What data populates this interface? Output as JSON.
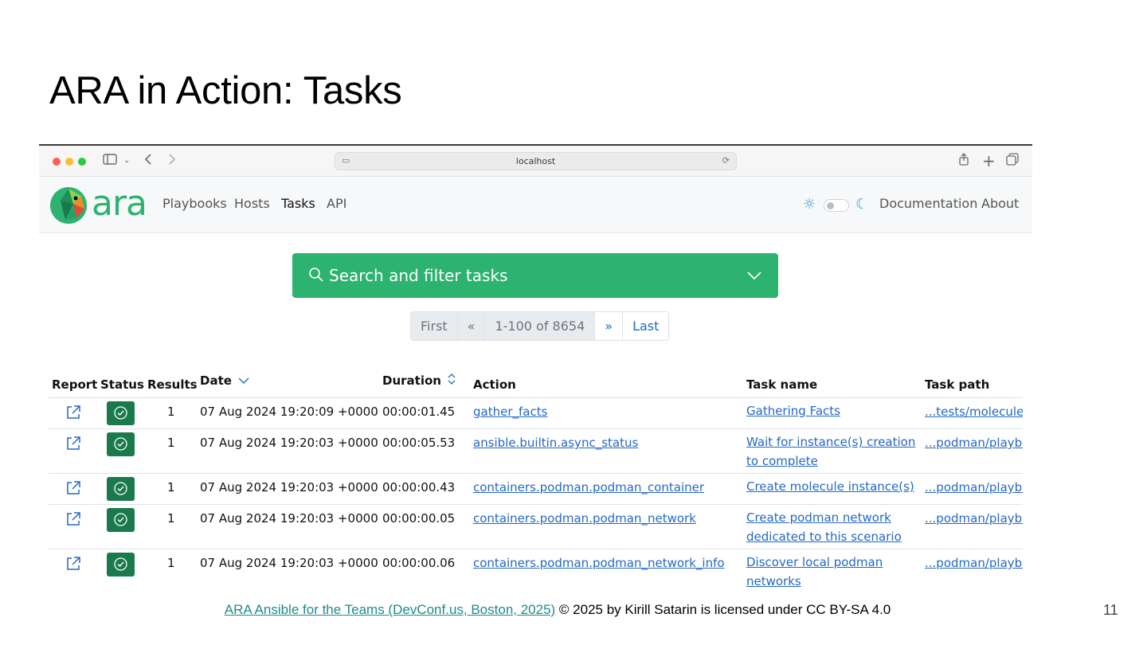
{
  "slide": {
    "title": "ARA in Action: Tasks",
    "page_number": "11",
    "footer_link": "ARA Ansible for the Teams (DevConf.us, Boston, 2025)",
    "footer_text": " © 2025 by Kirill Satarin is licensed under CC BY-SA 4.0"
  },
  "browser": {
    "url": "localhost"
  },
  "navbar": {
    "brand": "ara",
    "links": [
      "Playbooks",
      "Hosts",
      "Tasks",
      "API"
    ],
    "active": "Tasks",
    "right_links": [
      "Documentation",
      "About"
    ]
  },
  "search": {
    "label": "Search and filter tasks"
  },
  "pagination": {
    "first": "First",
    "prev": "«",
    "range": "1-100 of 8654",
    "next": "»",
    "last": "Last"
  },
  "table": {
    "columns": [
      "Report",
      "Status",
      "Results",
      "Date",
      "Duration",
      "Action",
      "Task name",
      "Task path"
    ],
    "rows": [
      {
        "results": "1",
        "date": "07 Aug 2024 19:20:09 +0000",
        "duration": "00:00:01.45",
        "action": "gather_facts",
        "task_name": "Gathering Facts",
        "task_path": "...tests/molecule/"
      },
      {
        "results": "1",
        "date": "07 Aug 2024 19:20:03 +0000",
        "duration": "00:00:05.53",
        "action": "ansible.builtin.async_status",
        "task_name": "Wait for instance(s) creation to complete",
        "task_path": "...podman/playbo"
      },
      {
        "results": "1",
        "date": "07 Aug 2024 19:20:03 +0000",
        "duration": "00:00:00.43",
        "action": "containers.podman.podman_container",
        "task_name": "Create molecule instance(s)",
        "task_path": "...podman/playbo"
      },
      {
        "results": "1",
        "date": "07 Aug 2024 19:20:03 +0000",
        "duration": "00:00:00.05",
        "action": "containers.podman.podman_network",
        "task_name": "Create podman network dedicated to this scenario",
        "task_path": "...podman/playbo"
      },
      {
        "results": "1",
        "date": "07 Aug 2024 19:20:03 +0000",
        "duration": "00:00:00.06",
        "action": "containers.podman.podman_network_info",
        "task_name": "Discover local podman networks",
        "task_path": "...podman/playbo"
      }
    ]
  },
  "colors": {
    "accent_green": "#2bb36f",
    "status_green": "#1a7a4c",
    "link_blue": "#2468c4"
  }
}
